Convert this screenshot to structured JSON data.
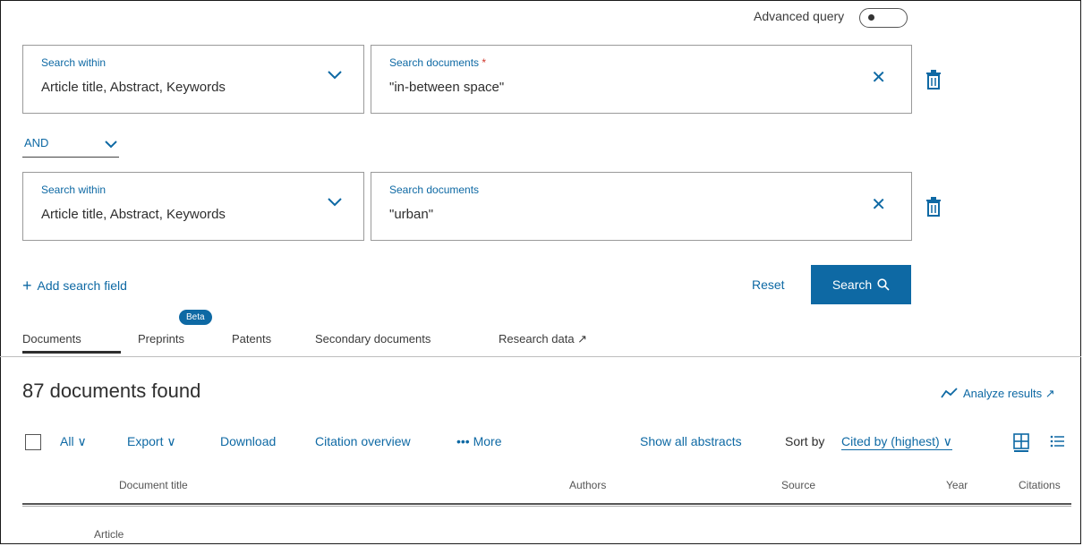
{
  "advanced_query": {
    "label": "Advanced query"
  },
  "rows": [
    {
      "within_label": "Search within",
      "within_value": "Article title, Abstract, Keywords",
      "docs_label": "Search documents",
      "docs_required_mark": "*",
      "docs_value": "\"in-between space\""
    },
    {
      "within_label": "Search within",
      "within_value": "Article title, Abstract, Keywords",
      "docs_label": "Search documents",
      "docs_value": "\"urban\""
    }
  ],
  "operator": "AND",
  "clear_symbol": "✕",
  "add_field": {
    "symbol": "+",
    "label": "Add search field"
  },
  "reset_label": "Reset",
  "search_button": {
    "label": "Search"
  },
  "beta_badge": "Beta",
  "tabs": [
    {
      "label": "Documents"
    },
    {
      "label": "Preprints"
    },
    {
      "label": "Patents"
    },
    {
      "label": "Secondary documents"
    },
    {
      "label": "Research data ↗"
    }
  ],
  "results": {
    "count_text": "87 documents found",
    "analyze_label": "Analyze results ↗"
  },
  "toolbar": {
    "all_label": "All ∨",
    "export_label": "Export ∨",
    "download_label": "Download",
    "citation_overview_label": "Citation overview",
    "more_label": "••• More",
    "show_abstracts_label": "Show all abstracts",
    "sort_by_label": "Sort by",
    "sort_value": "Cited by (highest) ∨"
  },
  "columns": [
    "Document title",
    "Authors",
    "Source",
    "Year",
    "Citations"
  ],
  "first_row_type": "Article",
  "colors": {
    "accent": "#0e69a4"
  }
}
